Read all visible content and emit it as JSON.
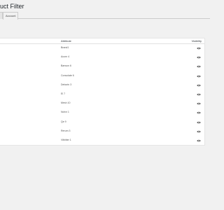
{
  "page": {
    "title": "uct Filter"
  },
  "tabs": [
    {
      "label": ""
    },
    {
      "label": "Account"
    }
  ],
  "table": {
    "headers": {
      "attribute": "Attribute",
      "visibility": "Visibility"
    },
    "rows": [
      {
        "attribute": "Brand1"
      },
      {
        "attribute": "Acorn 4"
      },
      {
        "attribute": "Barwon 6"
      },
      {
        "attribute": "Consolate 6"
      },
      {
        "attribute": "Deborin 3"
      },
      {
        "attribute": "El 7"
      },
      {
        "attribute": "Mesh 10"
      },
      {
        "attribute": "Nolvn 1"
      },
      {
        "attribute": "Qe 9"
      },
      {
        "attribute": "Rerum 3"
      },
      {
        "attribute": "Vitbitter 1"
      }
    ]
  },
  "icons": {
    "visibility": "eye-icon"
  },
  "colors": {
    "background": "#f1f1f1",
    "panel": "#ffffff",
    "text": "#555555"
  }
}
